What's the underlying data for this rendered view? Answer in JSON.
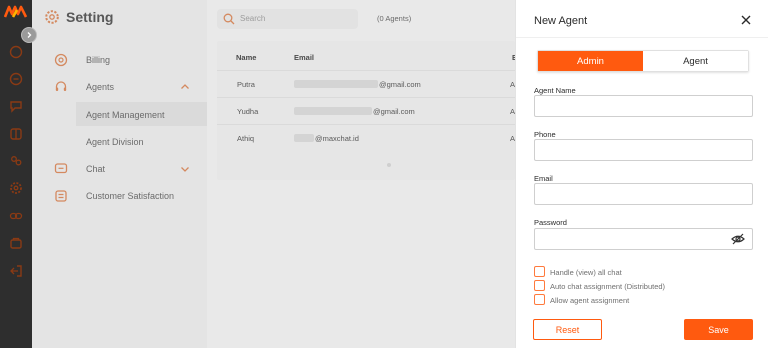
{
  "settings": {
    "title": "Setting",
    "billing": "Billing",
    "agents": "Agents",
    "agent_management": "Agent Management",
    "agent_division": "Agent Division",
    "chat": "Chat",
    "customer_satisfaction": "Customer Satisfaction"
  },
  "main": {
    "search_placeholder": "Search",
    "agents_count": "(0 Agents)",
    "columns": {
      "name": "Name",
      "email": "Email",
      "extra": "E"
    },
    "rows": [
      {
        "name": "Putra",
        "email": "@gmail.com",
        "col3": "A"
      },
      {
        "name": "Yudha",
        "email": "@gmail.com",
        "col3": "A"
      },
      {
        "name": "Athiq",
        "email": "@maxchat.id",
        "col3": "A"
      }
    ]
  },
  "panel": {
    "title": "New Agent",
    "role_tabs": {
      "admin": "Admin",
      "agent": "Agent"
    },
    "fields": {
      "agent_name_label": "Agent Name",
      "phone_label": "Phone",
      "email_label": "Email",
      "password_label": "Password"
    },
    "options": {
      "handle_all": "Handle (view) all chat",
      "auto_assign": "Auto chat assignment (Distributed)",
      "allow_assign": "Allow agent assignment"
    },
    "reset_label": "Reset",
    "save_label": "Save"
  },
  "colors": {
    "accent": "#ff5a0f",
    "rail": "#2e2e2e"
  }
}
